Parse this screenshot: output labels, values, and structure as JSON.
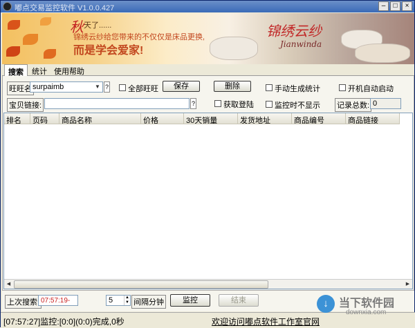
{
  "window": {
    "title": "嘟点交易监控软件 V1.0.0.427",
    "minimize": "–",
    "maximize": "□",
    "close": "×"
  },
  "banner": {
    "autumn_char": "秋",
    "line1": "天了......",
    "line2": "锦绣云纱给您带来的不仅仅是床品更换,",
    "line3": "而是学会爱家!",
    "brand_cn": "锦绣云纱",
    "brand_en": "Jianwinda"
  },
  "tabs": [
    {
      "label": "搜索"
    },
    {
      "label": "统计"
    },
    {
      "label": "使用帮助"
    }
  ],
  "form": {
    "wangwang_label": "旺旺名",
    "wangwang_value": "surpaimb",
    "help_q": "?",
    "all_wangwang_label": "全部旺旺",
    "save_label": "保存",
    "delete_label": "删除",
    "manual_stats_label": "手动生成统计",
    "autostart_label": "开机自动启动",
    "item_link_label": "宝贝链接:",
    "item_link_value": "",
    "get_login_label": "获取登陆",
    "hide_when_monitor_label": "监控时不显示",
    "record_total_label": "记录总数:",
    "record_total_value": "0"
  },
  "list": {
    "columns": [
      "排名",
      "页码",
      "商品名称",
      "价格",
      "30天销量",
      "发货地址",
      "商品编号",
      "商品链接"
    ]
  },
  "bottom": {
    "last_search_label": "上次搜索:",
    "last_search_time": "07:57:19-",
    "interval_value": "5",
    "interval_label": "间隔分钟",
    "monitor_label": "监控",
    "end_label": "结束"
  },
  "status": {
    "log": "[07:57:27]监控:[0:0](0:0)完成,0秒",
    "welcome": "欢迎访问嘟点软件工作室官网"
  },
  "watermark": {
    "icon_char": "↓",
    "cn": "当下软件园",
    "en": "downxia.com"
  }
}
